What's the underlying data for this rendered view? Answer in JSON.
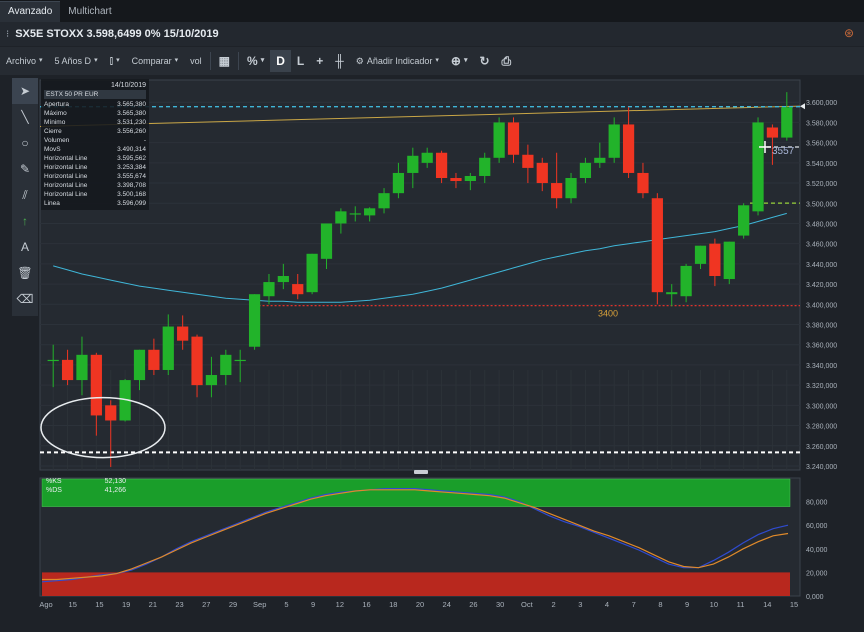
{
  "tabs": [
    {
      "label": "Avanzado",
      "active": true
    },
    {
      "label": "Multichart",
      "active": false
    }
  ],
  "title": "SX5E STOXX 3.598,6499 0% 15/10/2019",
  "toolbar": {
    "archivo": "Archivo",
    "period": "5 Años D",
    "comparar": "Comparar",
    "vol": "vol",
    "percent": "%",
    "d": "D",
    "l": "L",
    "add_indicator": "Añadir Indicador"
  },
  "icons": {
    "tools": [
      "cursor-icon",
      "line-icon",
      "circle-icon",
      "pen-icon",
      "fibonacci-icon",
      "arrow-icon",
      "text-icon",
      "trash-icon",
      "eraser-icon"
    ]
  },
  "info": {
    "date": "14/10/2019",
    "name": "ESTX 50 PR EUR",
    "rows": [
      {
        "label": "Apertura",
        "value": "3.565,380"
      },
      {
        "label": "Máximo",
        "value": "3.565,380"
      },
      {
        "label": "Mínimo",
        "value": "3.531,230"
      },
      {
        "label": "Cierre",
        "value": "3.556,260"
      },
      {
        "label": "Volumen",
        "value": "-"
      },
      {
        "label": "MovS",
        "value": "3.490,314"
      },
      {
        "label": "Horizontal Line",
        "value": "3.595,562"
      },
      {
        "label": "Horizontal Line",
        "value": "3.253,384"
      },
      {
        "label": "Horizontal Line",
        "value": "3.555,674"
      },
      {
        "label": "Horizontal Line",
        "value": "3.398,708"
      },
      {
        "label": "Horizontal Line",
        "value": "3.500,168"
      },
      {
        "label": "Linea",
        "value": "3.596,099"
      }
    ]
  },
  "oscillator": {
    "k_label": "%KS",
    "k_value": "52,130",
    "d_label": "%DS",
    "d_value": "41,266",
    "overbought": 80,
    "oversold": 20,
    "yticks": [
      "80,000",
      "60,000",
      "40,000",
      "20,000",
      "0,000"
    ],
    "colors": {
      "k": "#2f4bd0",
      "d": "#e08a2a",
      "overbought": "#1a9e2a",
      "oversold": "#b8281e"
    }
  },
  "chart_data": {
    "type": "candlestick",
    "yticks": [
      "3.600,000",
      "3.580,000",
      "3.560,000",
      "3.540,000",
      "3.520,000",
      "3.500,000",
      "3.480,000",
      "3.460,000",
      "3.440,000",
      "3.420,000",
      "3.400,000",
      "3.380,000",
      "3.360,000",
      "3.340,000",
      "3.320,000",
      "3.300,000",
      "3.280,000",
      "3.260,000",
      "3.240,000"
    ],
    "ylim": [
      3236,
      3622
    ],
    "xticks": [
      "Ago",
      "15",
      "15",
      "19",
      "21",
      "23",
      "27",
      "29",
      "Sep",
      "5",
      "9",
      "12",
      "16",
      "18",
      "20",
      "24",
      "26",
      "30",
      "Oct",
      "2",
      "3",
      "4",
      "7",
      "8",
      "9",
      "10",
      "11",
      "14",
      "15"
    ],
    "candles": [
      {
        "o": 3345,
        "h": 3360,
        "l": 3318,
        "c": 3345
      },
      {
        "o": 3345,
        "h": 3355,
        "l": 3320,
        "c": 3325
      },
      {
        "o": 3325,
        "h": 3368,
        "l": 3310,
        "c": 3350
      },
      {
        "o": 3350,
        "h": 3352,
        "l": 3270,
        "c": 3290
      },
      {
        "o": 3300,
        "h": 3305,
        "l": 3239,
        "c": 3285
      },
      {
        "o": 3285,
        "h": 3326,
        "l": 3284,
        "c": 3325
      },
      {
        "o": 3325,
        "h": 3355,
        "l": 3315,
        "c": 3355
      },
      {
        "o": 3355,
        "h": 3366,
        "l": 3330,
        "c": 3335
      },
      {
        "o": 3335,
        "h": 3390,
        "l": 3330,
        "c": 3378
      },
      {
        "o": 3378,
        "h": 3389,
        "l": 3355,
        "c": 3364
      },
      {
        "o": 3368,
        "h": 3370,
        "l": 3308,
        "c": 3320
      },
      {
        "o": 3320,
        "h": 3348,
        "l": 3308,
        "c": 3330
      },
      {
        "o": 3330,
        "h": 3355,
        "l": 3320,
        "c": 3350
      },
      {
        "o": 3345,
        "h": 3355,
        "l": 3323,
        "c": 3345
      },
      {
        "o": 3358,
        "h": 3410,
        "l": 3355,
        "c": 3410
      },
      {
        "o": 3408,
        "h": 3430,
        "l": 3400,
        "c": 3422
      },
      {
        "o": 3422,
        "h": 3440,
        "l": 3415,
        "c": 3428
      },
      {
        "o": 3420,
        "h": 3430,
        "l": 3405,
        "c": 3410
      },
      {
        "o": 3412,
        "h": 3450,
        "l": 3410,
        "c": 3450
      },
      {
        "o": 3445,
        "h": 3480,
        "l": 3435,
        "c": 3480
      },
      {
        "o": 3480,
        "h": 3495,
        "l": 3470,
        "c": 3492
      },
      {
        "o": 3490,
        "h": 3497,
        "l": 3482,
        "c": 3490
      },
      {
        "o": 3488,
        "h": 3496,
        "l": 3482,
        "c": 3495
      },
      {
        "o": 3495,
        "h": 3515,
        "l": 3490,
        "c": 3510
      },
      {
        "o": 3510,
        "h": 3540,
        "l": 3505,
        "c": 3530
      },
      {
        "o": 3530,
        "h": 3555,
        "l": 3515,
        "c": 3547
      },
      {
        "o": 3540,
        "h": 3555,
        "l": 3535,
        "c": 3550
      },
      {
        "o": 3550,
        "h": 3552,
        "l": 3520,
        "c": 3525
      },
      {
        "o": 3525,
        "h": 3530,
        "l": 3515,
        "c": 3522
      },
      {
        "o": 3522,
        "h": 3530,
        "l": 3513,
        "c": 3527
      },
      {
        "o": 3527,
        "h": 3550,
        "l": 3520,
        "c": 3545
      },
      {
        "o": 3545,
        "h": 3585,
        "l": 3540,
        "c": 3580
      },
      {
        "o": 3580,
        "h": 3585,
        "l": 3540,
        "c": 3548
      },
      {
        "o": 3548,
        "h": 3558,
        "l": 3520,
        "c": 3535
      },
      {
        "o": 3540,
        "h": 3545,
        "l": 3512,
        "c": 3520
      },
      {
        "o": 3520,
        "h": 3550,
        "l": 3495,
        "c": 3505
      },
      {
        "o": 3505,
        "h": 3530,
        "l": 3500,
        "c": 3525
      },
      {
        "o": 3525,
        "h": 3545,
        "l": 3520,
        "c": 3540
      },
      {
        "o": 3540,
        "h": 3560,
        "l": 3535,
        "c": 3545
      },
      {
        "o": 3545,
        "h": 3585,
        "l": 3540,
        "c": 3578
      },
      {
        "o": 3578,
        "h": 3595,
        "l": 3525,
        "c": 3530
      },
      {
        "o": 3530,
        "h": 3540,
        "l": 3505,
        "c": 3510
      },
      {
        "o": 3505,
        "h": 3510,
        "l": 3400,
        "c": 3412
      },
      {
        "o": 3410,
        "h": 3420,
        "l": 3398,
        "c": 3412
      },
      {
        "o": 3408,
        "h": 3440,
        "l": 3402,
        "c": 3438
      },
      {
        "o": 3440,
        "h": 3458,
        "l": 3435,
        "c": 3458
      },
      {
        "o": 3460,
        "h": 3465,
        "l": 3418,
        "c": 3428
      },
      {
        "o": 3425,
        "h": 3462,
        "l": 3420,
        "c": 3462
      },
      {
        "o": 3468,
        "h": 3500,
        "l": 3465,
        "c": 3498
      },
      {
        "o": 3492,
        "h": 3585,
        "l": 3488,
        "c": 3580
      },
      {
        "o": 3575,
        "h": 3578,
        "l": 3538,
        "c": 3565
      },
      {
        "o": 3565,
        "h": 3610,
        "l": 3562,
        "c": 3595
      }
    ],
    "ma": [
      3438,
      3434,
      3430,
      3427,
      3424,
      3421,
      3418,
      3416,
      3414,
      3412,
      3410,
      3408,
      3406,
      3405,
      3404,
      3403,
      3403,
      3402,
      3402,
      3402,
      3402,
      3403,
      3404,
      3406,
      3408,
      3410,
      3413,
      3416,
      3420,
      3424,
      3428,
      3432,
      3436,
      3440,
      3444,
      3447,
      3450,
      3453,
      3455,
      3458,
      3460,
      3462,
      3464,
      3466,
      3468,
      3470,
      3472,
      3475,
      3478,
      3482,
      3486,
      3490
    ],
    "hlines": [
      {
        "value": 3595.562,
        "color": "#3fb6d8",
        "style": "dash"
      },
      {
        "value": 3253.384,
        "color": "#ffffff",
        "style": "dash"
      },
      {
        "value": 3555.674,
        "color": "#dfe4ea",
        "style": "dash"
      },
      {
        "value": 3398.708,
        "color": "#e0322a",
        "style": "dot"
      },
      {
        "value": 3500.168,
        "color": "#98d23a",
        "style": "dash"
      }
    ],
    "trendline": {
      "start": 3576,
      "end": 3596.099,
      "color": "#c9a646"
    },
    "label_3400": "3400",
    "label_3557": "3557",
    "up_color": "#22b32a",
    "down_color": "#f03522"
  }
}
